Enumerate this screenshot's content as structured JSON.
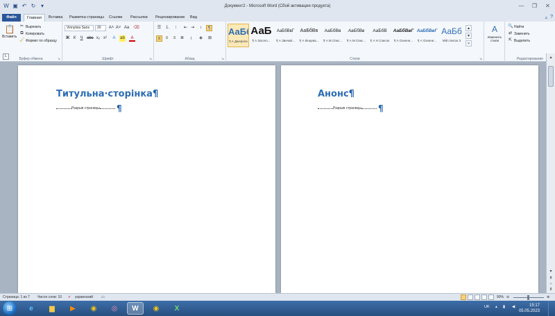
{
  "window": {
    "title": "Документ2 - Microsoft Word (Сбой активации продукта)"
  },
  "tabs": {
    "file": "Файл",
    "items": [
      "Главная",
      "Вставка",
      "Разметка страницы",
      "Ссылки",
      "Рассылки",
      "Рецензирование",
      "Вид"
    ]
  },
  "ribbon": {
    "clipboard": {
      "paste": "Вставить",
      "cut": "Вырезать",
      "copy": "Копировать",
      "format_painter": "Формат по образцу",
      "label": "Буфер обмена"
    },
    "font": {
      "name": "Vinnytsia Sans",
      "size": "20",
      "label": "Шрифт"
    },
    "paragraph": {
      "label": "Абзац"
    },
    "styles": {
      "label": "Стили",
      "tiles": [
        {
          "sample": "АаБб",
          "name": "¶ А Джерела"
        },
        {
          "sample": "АаБ",
          "name": "¶ А Заголо..."
        },
        {
          "sample": "АаБбВвГ",
          "name": "¶ А Звичай..."
        },
        {
          "sample": "АаБбВв",
          "name": "¶ А Кінцева..."
        },
        {
          "sample": "АаБбВв",
          "name": "¶ А М Спис..."
        },
        {
          "sample": "АаБбВв",
          "name": "¶ А М Спис..."
        },
        {
          "sample": "АаБбВ",
          "name": "¶ А Н Список"
        },
        {
          "sample": "АаБбВвГ",
          "name": "¶ А Означе..."
        },
        {
          "sample": "АаБбВвГ",
          "name": "¶ А Означе..."
        },
        {
          "sample": "АаБб",
          "name": "Мій список 3"
        }
      ],
      "change_styles": "Изменить стили"
    },
    "editing": {
      "find": "Найти",
      "replace": "Заменить",
      "select": "Выделить",
      "label": "Редактирование"
    }
  },
  "pages": [
    {
      "heading": "Титульна·сторінка",
      "pilcrow": "¶",
      "page_break": "Разрыв страницы"
    },
    {
      "heading": "Анонс",
      "pilcrow": "¶",
      "page_break": "Разрыв страницы"
    }
  ],
  "statusbar": {
    "page": "Страница: 1 из 7",
    "words": "Число слов: 10",
    "language": "украинский",
    "zoom": "90%"
  },
  "taskbar": {
    "lang": "UK",
    "time": "15:17",
    "date": "05.05.2023"
  },
  "colors": {
    "heading": "#2e6db4",
    "file_tab": "#2a5599"
  }
}
